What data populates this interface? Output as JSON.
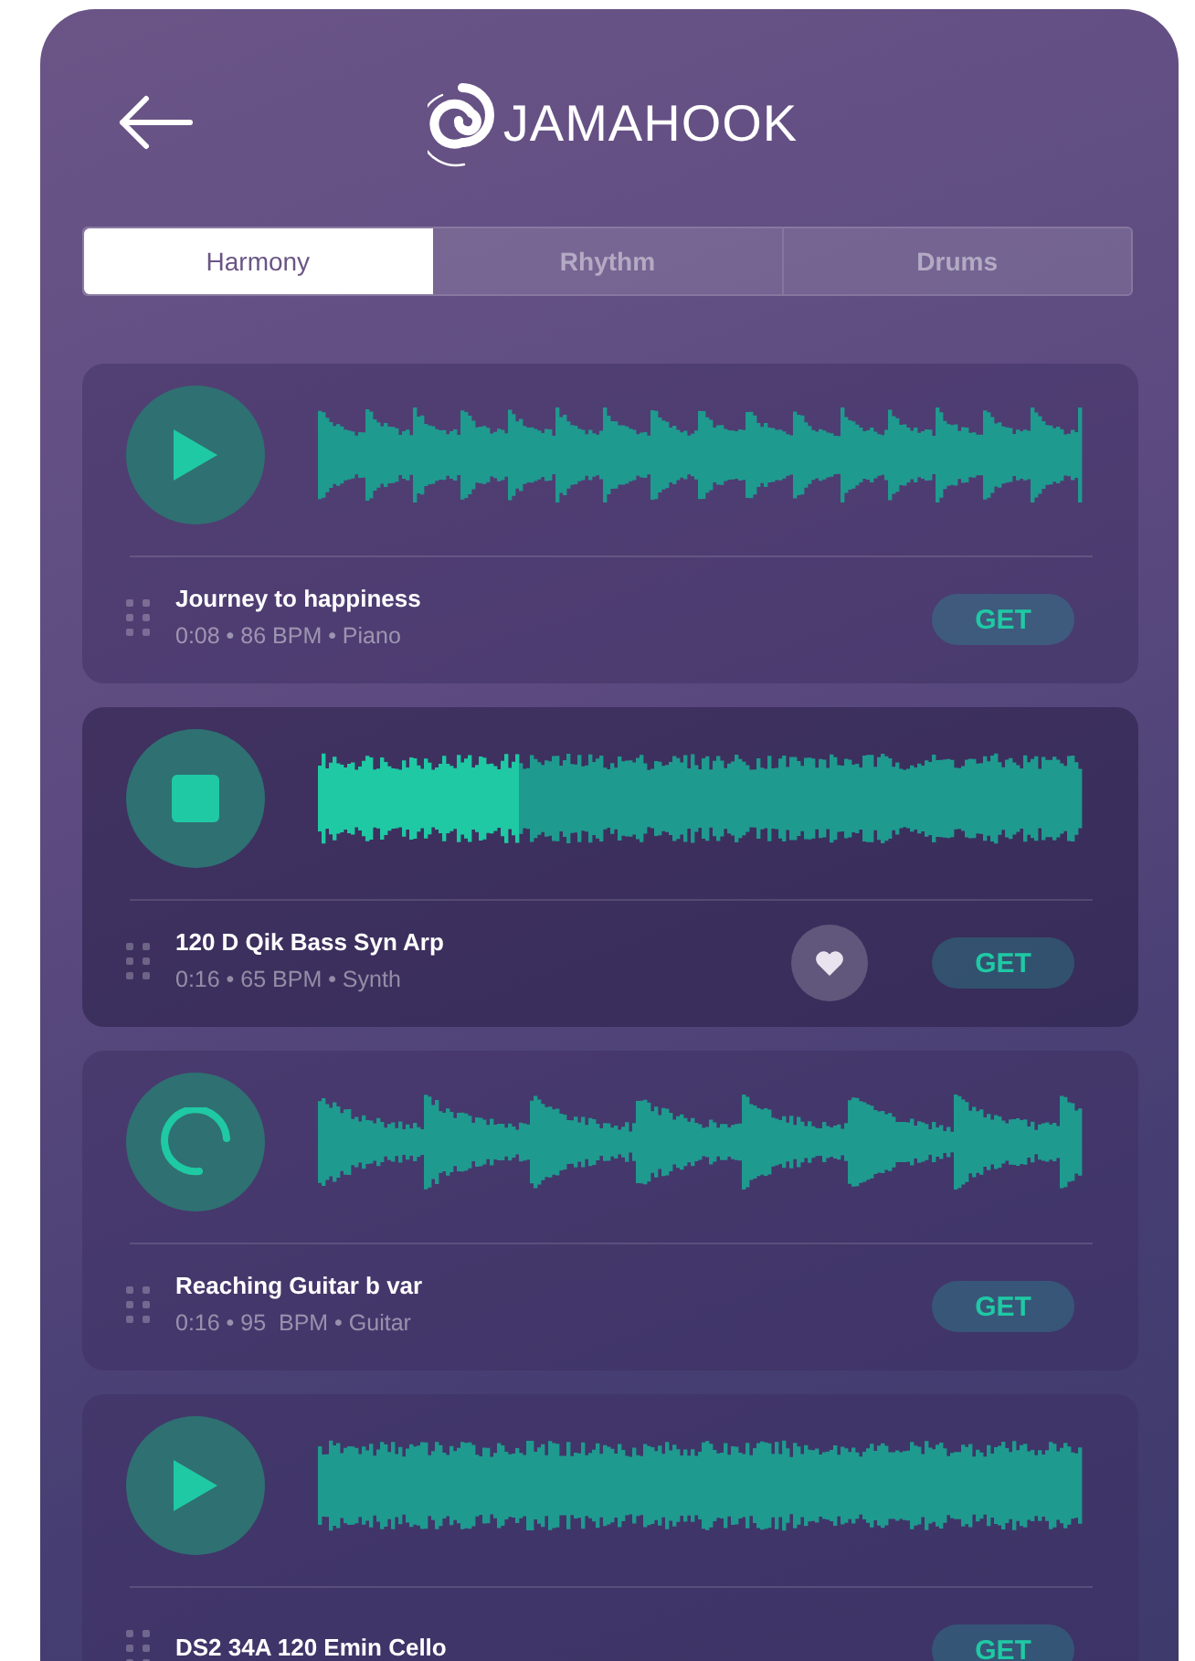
{
  "header": {
    "logo": "JAMAHOOK"
  },
  "tabs": [
    {
      "label": "Harmony",
      "selected": true
    },
    {
      "label": "Rhythm",
      "selected": false
    },
    {
      "label": "Drums",
      "selected": false
    }
  ],
  "tracks": [
    {
      "kind": "play",
      "active": false,
      "title": "Journey to happiness",
      "details": "0:08 • 86 BPM • Piano",
      "action": "GET"
    },
    {
      "kind": "stop",
      "active": true,
      "level": 0.26,
      "title": "120 D Qik Bass Syn Arp",
      "details": "0:16 • 65 BPM • Synth",
      "action": "GET"
    },
    {
      "kind": "loading",
      "active": false,
      "title": "Reaching Guitar b var",
      "details": "0:16 • 95  BPM • Guitar",
      "action": "GET"
    },
    {
      "kind": "play",
      "active": false,
      "title": "DS2 34A 120 Emin Cello",
      "action": "GET"
    }
  ]
}
